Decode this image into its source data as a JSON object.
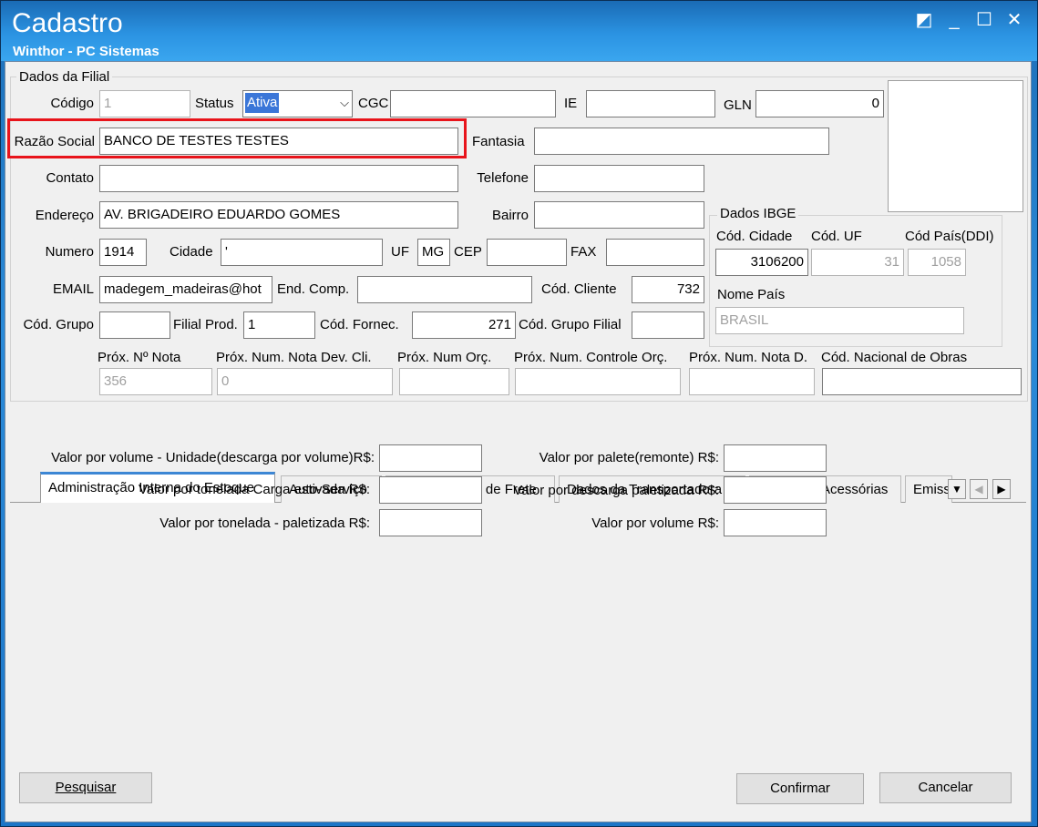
{
  "window": {
    "title": "Cadastro",
    "subtitle": "Winthor - PC Sistemas",
    "controls": {
      "restore": "◩",
      "minimize": "_",
      "maximize": "☐",
      "close": "✕"
    }
  },
  "filial": {
    "group_title": "Dados da Filial",
    "codigo_label": "Código",
    "codigo_value": "1",
    "status_label": "Status",
    "status_value": "Ativa",
    "cgc_label": "CGC",
    "cgc_value": "",
    "ie_label": "IE",
    "ie_value": "",
    "gln_label": "GLN",
    "gln_value": "0",
    "razao_label": "Razão Social",
    "razao_value": "BANCO DE TESTES TESTES",
    "fantasia_label": "Fantasia",
    "fantasia_value": "",
    "contato_label": "Contato",
    "contato_value": "",
    "telefone_label": "Telefone",
    "telefone_value": "",
    "endereco_label": "Endereço",
    "endereco_value": "AV. BRIGADEIRO EDUARDO GOMES",
    "bairro_label": "Bairro",
    "bairro_value": "",
    "numero_label": "Numero",
    "numero_value": "1914",
    "cidade_label": "Cidade",
    "cidade_value": "'",
    "uf_label": "UF",
    "uf_value": "MG",
    "cep_label": "CEP",
    "cep_value": "",
    "fax_label": "FAX",
    "fax_value": "",
    "email_label": "EMAIL",
    "email_value": "madegem_madeiras@hot",
    "endcomp_label": "End. Comp.",
    "endcomp_value": "",
    "codcliente_label": "Cód. Cliente",
    "codcliente_value": "732",
    "codgrupo_label": "Cód. Grupo",
    "codgrupo_value": "",
    "filialprod_label": "Filial Prod.",
    "filialprod_value": "1",
    "codfornec_label": "Cód. Fornec.",
    "codfornec_value": "271",
    "codgrupofilial_label": "Cód. Grupo Filial",
    "codgrupofilial_value": "",
    "proxnota_label": "Próx. Nº Nota",
    "proxnota_value": "356",
    "proxdevcli_label": "Próx. Num. Nota Dev. Cli.",
    "proxdevcli_value": "0",
    "proxorc_label": "Próx. Num Orç.",
    "proxorc_value": "",
    "proxcontrole_label": "Próx. Num. Controle Orç.",
    "proxcontrole_value": "",
    "proxnotad_label": "Próx. Num. Nota D.",
    "proxnotad_value": "",
    "codobras_label": "Cód. Nacional de Obras",
    "codobras_value": ""
  },
  "ibge": {
    "group_title": "Dados IBGE",
    "codcidade_label": "Cód. Cidade",
    "codcidade_value": "3106200",
    "coduf_label": "Cód. UF",
    "coduf_value": "31",
    "codpais_label": "Cód País(DDI)",
    "codpais_value": "1058",
    "nomepais_label": "Nome País",
    "nomepais_value": "BRASIL"
  },
  "tabs": [
    {
      "label": "Administração Interna do Estoque"
    },
    {
      "label": "Auto-Serviço"
    },
    {
      "label": "Conhecimento de Frete"
    },
    {
      "label": "Dados da Transportadora"
    },
    {
      "label": "Despesas Acessórias"
    },
    {
      "label": "Emiss"
    }
  ],
  "tab_content": {
    "vol_unidade_label": "Valor por volume - Unidade(descarga por volume)R$:",
    "ton_estivada_label": "Valor por tonelada Carga estivada R$:",
    "ton_paletizada_label": "Valor por tonelada - paletizada R$:",
    "palete_remonte_label": "Valor por palete(remonte) R$:",
    "descarga_paletizada_label": "Valor por descarga paletizada R$:",
    "volume_label": "Valor por volume R$:"
  },
  "buttons": {
    "pesquisar": "Pesquisar",
    "confirmar": "Confirmar",
    "cancelar": "Cancelar"
  },
  "colors": {
    "highlight": "#e8141b",
    "tab_accent": "#3c86d4",
    "select_highlight": "#3a76d8"
  }
}
